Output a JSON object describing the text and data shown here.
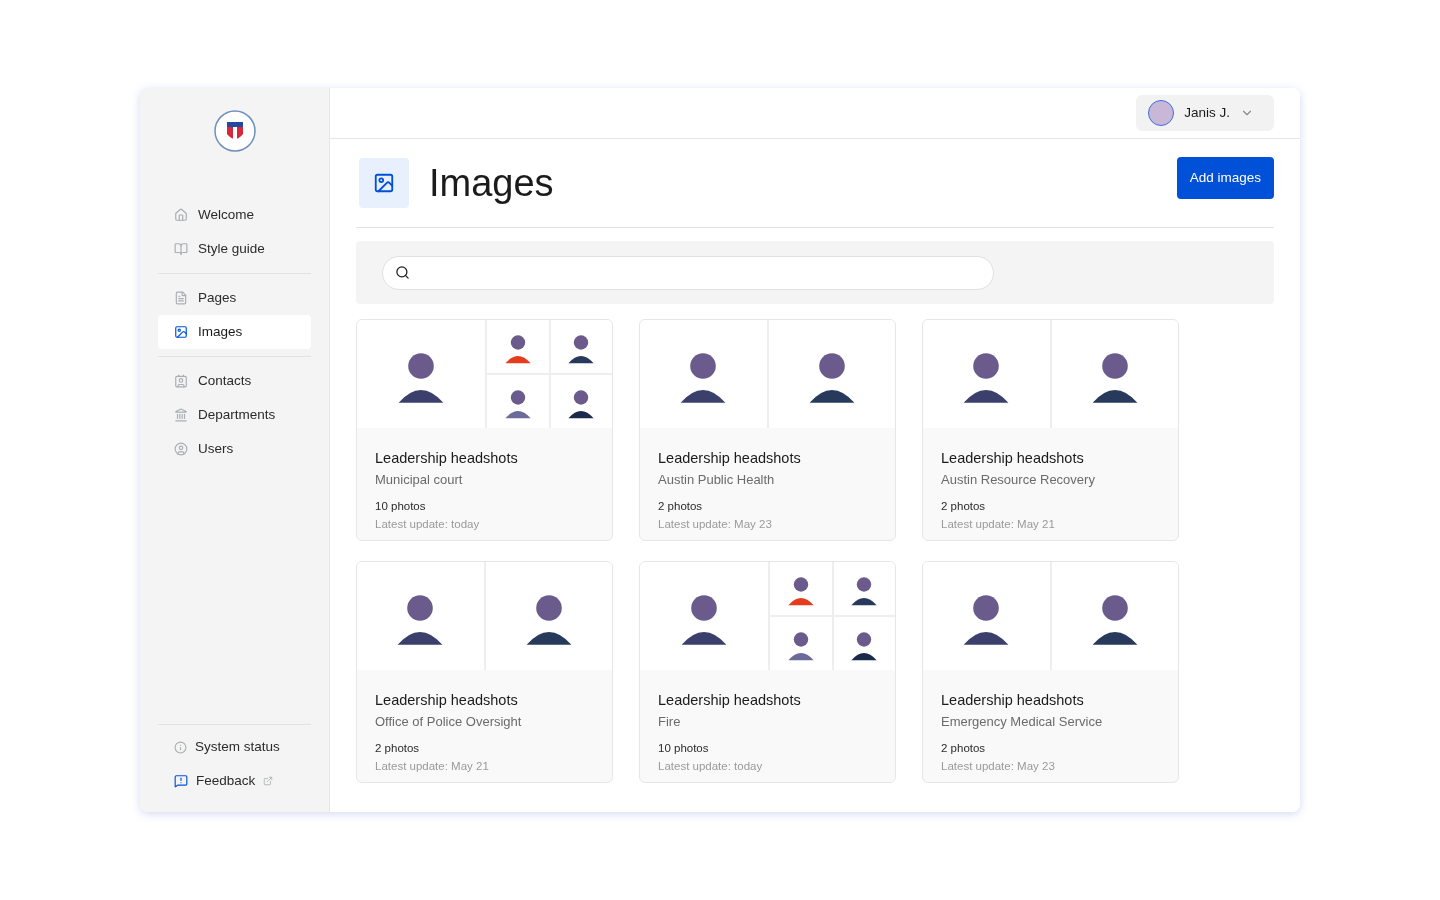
{
  "sidebar": {
    "groups": [
      [
        {
          "label": "Welcome",
          "selected": false
        },
        {
          "label": "Style guide",
          "selected": false
        }
      ],
      [
        {
          "label": "Pages",
          "selected": false
        },
        {
          "label": "Images",
          "selected": true
        }
      ],
      [
        {
          "label": "Contacts",
          "selected": false
        },
        {
          "label": "Departments",
          "selected": false
        },
        {
          "label": "Users",
          "selected": false
        }
      ]
    ],
    "footer": [
      {
        "label": "System status",
        "kind": "info"
      },
      {
        "label": "Feedback",
        "kind": "external"
      }
    ]
  },
  "user": {
    "name": "Janis J."
  },
  "page": {
    "title": "Images",
    "action": "Add images"
  },
  "cards": [
    {
      "title": "Leadership headshots",
      "department": "Municipal court",
      "count": "10 photos",
      "updated": "Latest update: today",
      "kind": "mosaic"
    },
    {
      "title": "Leadership headshots",
      "department": "Austin Public Health",
      "count": "2 photos",
      "updated": "Latest update: May 23",
      "kind": "pair"
    },
    {
      "title": "Leadership headshots",
      "department": "Austin Resource Recovery",
      "count": "2 photos",
      "updated": "Latest update: May 21",
      "kind": "pair"
    },
    {
      "title": "Leadership headshots",
      "department": "Office of Police Oversight",
      "count": "2 photos",
      "updated": "Latest update: May 21",
      "kind": "pair"
    },
    {
      "title": "Leadership headshots",
      "department": "Fire",
      "count": "10 photos",
      "updated": "Latest update: today",
      "kind": "mosaic"
    },
    {
      "title": "Leadership headshots",
      "department": "Emergency Medical Service",
      "count": "2 photos",
      "updated": "Latest update: May 23",
      "kind": "pair"
    }
  ]
}
